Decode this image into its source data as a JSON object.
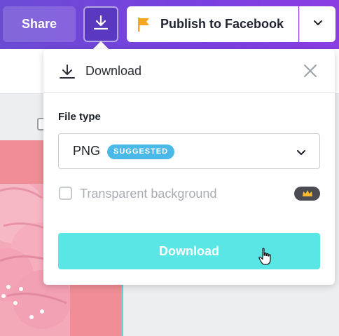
{
  "header": {
    "share_label": "Share",
    "download_icon": "download-icon",
    "publish_label": "Publish to Facebook",
    "publish_icon": "flag-icon",
    "menu_icon": "chevron-down-icon"
  },
  "download_panel": {
    "title": "Download",
    "title_icon": "download-icon",
    "close_icon": "close-icon",
    "file_type_label": "File type",
    "file_type_value": "PNG",
    "file_type_badge": "SUGGESTED",
    "transparent_background_label": "Transparent background",
    "transparent_background_checked": false,
    "premium_icon": "crown-icon",
    "download_button_label": "Download"
  },
  "colors": {
    "header_purple": "#7a3fe0",
    "download_button": "#5be6e6",
    "badge_blue": "#4bb9e8",
    "flag_orange": "#f5a623",
    "design_pink": "#f08d96"
  }
}
